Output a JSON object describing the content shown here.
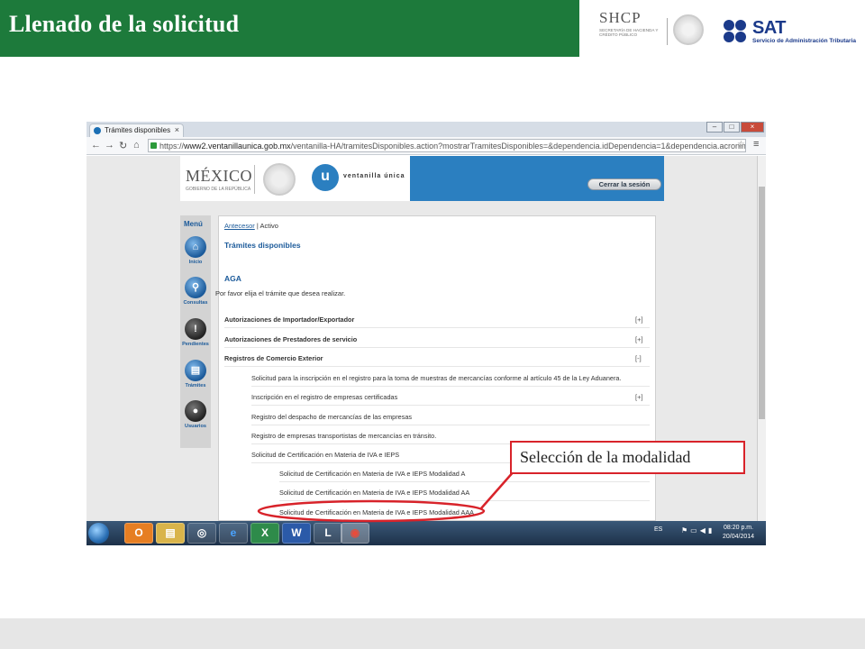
{
  "slide": {
    "title": "Llenado de la solicitud",
    "callout": "Selección de la modalidad"
  },
  "logos": {
    "shcp": "SHCP",
    "shcp_sub": "SECRETARÍA DE HACIENDA Y CRÉDITO PÚBLICO",
    "sat": "SAT",
    "sat_sub": "Servicio de Administración Tributaria"
  },
  "browser": {
    "tab_title": "Trámites disponibles",
    "url_scheme": "https://",
    "url_host": "www2.ventanillaunica.gob.mx",
    "url_path": "/ventanilla-HA/tramitesDisponibles.action?mostrarTramitesDisponibles=&dependencia.idDependencia=1&dependencia.acronimo"
  },
  "site": {
    "mexico": "MÉXICO",
    "gobierno": "GOBIERNO DE LA REPÚBLICA",
    "vu_letter": "u",
    "vu_name": "ventanilla única",
    "logout": "Cerrar la sesión"
  },
  "menu": {
    "title": "Menú",
    "items": [
      {
        "label": "Inicio",
        "icon": "home-icon"
      },
      {
        "label": "Consultas",
        "icon": "search-icon"
      },
      {
        "label": "Pendientes",
        "icon": "alert-icon"
      },
      {
        "label": "Trámites",
        "icon": "document-icon"
      },
      {
        "label": "Usuarios",
        "icon": "users-icon"
      }
    ]
  },
  "content": {
    "breadcrumb_link": "Antecesor",
    "breadcrumb_sep": "|",
    "breadcrumb_active": "Activo",
    "heading": "Trámites disponibles",
    "agency": "AGA",
    "instructions": "Por favor elija el trámite que desea realizar.",
    "rows": [
      {
        "label": "Autorizaciones de Importador/Exportador",
        "toggle": "[+]",
        "level": 0
      },
      {
        "label": "Autorizaciones de Prestadores de servicio",
        "toggle": "[+]",
        "level": 0
      },
      {
        "label": "Registros de Comercio Exterior",
        "toggle": "[-]",
        "level": 0
      },
      {
        "label": "Solicitud para la inscripción en el registro para la toma de muestras de mercancías conforme al artículo 45 de la Ley Aduanera.",
        "toggle": "",
        "level": 1
      },
      {
        "label": "Inscripción en el registro de empresas certificadas",
        "toggle": "[+]",
        "level": 1
      },
      {
        "label": "Registro del despacho de mercancías de las empresas",
        "toggle": "",
        "level": 1
      },
      {
        "label": "Registro de empresas transportistas de mercancías en tránsito.",
        "toggle": "",
        "level": 1
      },
      {
        "label": "Solicitud de Certificación en Materia de IVA e IEPS",
        "toggle": "[-]",
        "level": 1
      },
      {
        "label": "Solicitud de Certificación en Materia de IVA e IEPS Modalidad A",
        "toggle": "",
        "level": 2
      },
      {
        "label": "Solicitud de Certificación en Materia de IVA e IEPS Modalidad AA",
        "toggle": "",
        "level": 2
      },
      {
        "label": "Solicitud de Certificación en Materia de IVA e IEPS Modalidad AAA",
        "toggle": "",
        "level": 2
      }
    ]
  },
  "taskbar": {
    "lang": "ES",
    "time": "08:20 p.m.",
    "date": "20/04/2014",
    "apps": [
      "O",
      "▤",
      "◎",
      "e",
      "X",
      "W",
      "L",
      "◉"
    ]
  },
  "colors": {
    "title_green": "#1d7a3b",
    "link_blue": "#1b5a9a",
    "highlight_red": "#d8232a"
  }
}
